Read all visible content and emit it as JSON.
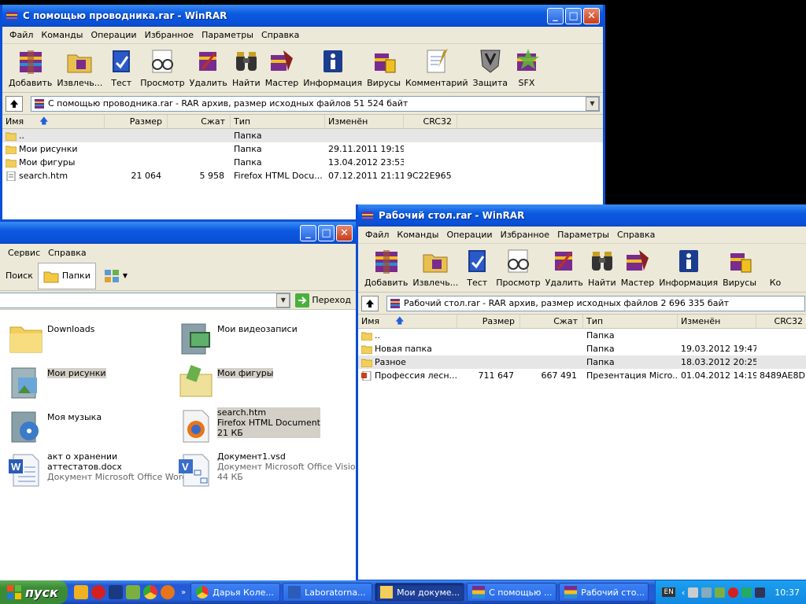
{
  "winrar_toolbar_labels": [
    "Добавить",
    "Извлечь...",
    "Тест",
    "Просмотр",
    "Удалить",
    "Найти",
    "Мастер",
    "Информация",
    "Вирусы",
    "Комментарий",
    "Защита",
    "SFX"
  ],
  "winrar_toolbar_icons": [
    "archive-stack-icon",
    "folder-extract-icon",
    "book-check-icon",
    "glasses-icon",
    "trash-archive-icon",
    "binoculars-icon",
    "wizard-icon",
    "info-icon",
    "virus-scan-icon",
    "comment-icon",
    "shield-icon",
    "sfx-icon"
  ],
  "win1": {
    "title": "С помощью проводника.rar - WinRAR",
    "menu": [
      "Файл",
      "Команды",
      "Операции",
      "Избранное",
      "Параметры",
      "Справка"
    ],
    "address": "С помощью проводника.rar - RAR архив, размер исходных файлов 51 524 байт",
    "columns": [
      "Имя",
      "Размер",
      "Сжат",
      "Тип",
      "Изменён",
      "CRC32"
    ],
    "rows": [
      {
        "name": "..",
        "size": "",
        "packed": "",
        "type": "Папка",
        "modified": "",
        "crc": ""
      },
      {
        "name": "Мои рисунки",
        "size": "",
        "packed": "",
        "type": "Папка",
        "modified": "29.11.2011 19:19",
        "crc": ""
      },
      {
        "name": "Мои фигуры",
        "size": "",
        "packed": "",
        "type": "Папка",
        "modified": "13.04.2012 23:53",
        "crc": ""
      },
      {
        "name": "search.htm",
        "size": "21 064",
        "packed": "5 958",
        "type": "Firefox HTML Docu...",
        "modified": "07.12.2011 21:11",
        "crc": "9C22E965"
      }
    ]
  },
  "explorer": {
    "menu": [
      "Сервис",
      "Справка"
    ],
    "search_label": "Поиск",
    "folders_label": "Папки",
    "go_label": "Переход",
    "items": [
      {
        "name": "Downloads",
        "line2": "",
        "line3": ""
      },
      {
        "name": "Мои видеозаписи",
        "line2": "",
        "line3": ""
      },
      {
        "name": "Мои рисунки",
        "line2": "",
        "line3": ""
      },
      {
        "name": "Мои фигуры",
        "line2": "",
        "line3": ""
      },
      {
        "name": "Моя музыка",
        "line2": "",
        "line3": ""
      },
      {
        "name": "search.htm",
        "line2": "Firefox HTML Document",
        "line3": "21 КБ"
      },
      {
        "name": "акт о хранении",
        "line2": "аттестатов.docx",
        "line3": "Документ Microsoft Office Word"
      },
      {
        "name": "Документ1.vsd",
        "line2": "Документ Microsoft Office Visio",
        "line3": "44 КБ"
      }
    ]
  },
  "win2": {
    "title": "Рабочий стол.rar - WinRAR",
    "menu": [
      "Файл",
      "Команды",
      "Операции",
      "Избранное",
      "Параметры",
      "Справка"
    ],
    "toolbar_extra": "Ко",
    "address": "Рабочий стол.rar - RAR архив, размер исходных файлов 2 696 335 байт",
    "columns": [
      "Имя",
      "Размер",
      "Сжат",
      "Тип",
      "Изменён",
      "CRC32"
    ],
    "rows": [
      {
        "name": "..",
        "size": "",
        "packed": "",
        "type": "Папка",
        "modified": "",
        "crc": ""
      },
      {
        "name": "Новая папка",
        "size": "",
        "packed": "",
        "type": "Папка",
        "modified": "19.03.2012 19:47",
        "crc": ""
      },
      {
        "name": "Разное",
        "size": "",
        "packed": "",
        "type": "Папка",
        "modified": "18.03.2012 20:25",
        "crc": ""
      },
      {
        "name": "Профессия лесн...",
        "size": "711 647",
        "packed": "667 491",
        "type": "Презентация Micro...",
        "modified": "01.04.2012 14:19",
        "crc": "8489AE8D"
      }
    ]
  },
  "taskbar": {
    "start_label": "пуск",
    "tasks": [
      "Дарья Коле...",
      "Laboratorna...",
      "Мои докуме...",
      "С помощью ...",
      "Рабочий сто..."
    ],
    "lang": "EN",
    "clock": "10:37"
  },
  "colors": {
    "xp_blue": "#0a4fd6",
    "folder_yellow": "#f5c842",
    "start_green": "#3c8c36"
  }
}
